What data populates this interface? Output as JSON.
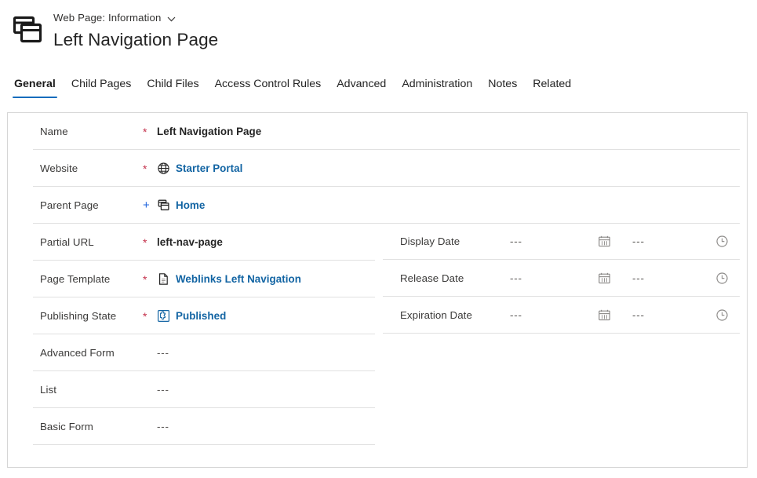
{
  "header": {
    "entity_icon": "web-page-stacked-icon",
    "breadcrumb": "Web Page: Information",
    "chevron_icon": "chevron-down-icon",
    "title": "Left Navigation Page"
  },
  "tabs": [
    {
      "label": "General",
      "active": true
    },
    {
      "label": "Child Pages",
      "active": false
    },
    {
      "label": "Child Files",
      "active": false
    },
    {
      "label": "Access Control Rules",
      "active": false
    },
    {
      "label": "Advanced",
      "active": false
    },
    {
      "label": "Administration",
      "active": false
    },
    {
      "label": "Notes",
      "active": false
    },
    {
      "label": "Related",
      "active": false
    }
  ],
  "form": {
    "left_fields": [
      {
        "label": "Name",
        "marker": "*",
        "marker_kind": "required",
        "value": "Left Navigation Page",
        "kind": "text"
      },
      {
        "label": "Website",
        "marker": "*",
        "marker_kind": "required",
        "value": "Starter Portal",
        "kind": "link",
        "icon": "globe-icon"
      },
      {
        "label": "Parent Page",
        "marker": "+",
        "marker_kind": "recommended",
        "value": "Home",
        "kind": "link",
        "icon": "pages-stacked-icon"
      },
      {
        "label": "Partial URL",
        "marker": "*",
        "marker_kind": "required",
        "value": "left-nav-page",
        "kind": "text"
      },
      {
        "label": "Page Template",
        "marker": "*",
        "marker_kind": "required",
        "value": "Weblinks Left Navigation",
        "kind": "link",
        "icon": "document-icon"
      },
      {
        "label": "Publishing State",
        "marker": "*",
        "marker_kind": "required",
        "value": "Published",
        "kind": "link",
        "icon": "puzzle-piece-icon"
      },
      {
        "label": "Advanced Form",
        "marker": "",
        "marker_kind": "none",
        "value": "---",
        "kind": "empty"
      },
      {
        "label": "List",
        "marker": "",
        "marker_kind": "none",
        "value": "---",
        "kind": "empty"
      },
      {
        "label": "Basic Form",
        "marker": "",
        "marker_kind": "none",
        "value": "---",
        "kind": "empty"
      }
    ],
    "right_fields": [
      {
        "label": "Display Date",
        "date_value": "---",
        "date_icon": "calendar-icon",
        "time_value": "---",
        "time_icon": "clock-icon"
      },
      {
        "label": "Release Date",
        "date_value": "---",
        "date_icon": "calendar-icon",
        "time_value": "---",
        "time_icon": "clock-icon"
      },
      {
        "label": "Expiration Date",
        "date_value": "---",
        "date_icon": "calendar-icon",
        "time_value": "---",
        "time_icon": "clock-icon"
      }
    ]
  },
  "colors": {
    "accent": "#0f6cbd",
    "link": "#1264a3",
    "required": "#c4314b",
    "recommended": "#2266dd",
    "divider": "#e1e1e1",
    "card_border": "#d6d6d6"
  }
}
